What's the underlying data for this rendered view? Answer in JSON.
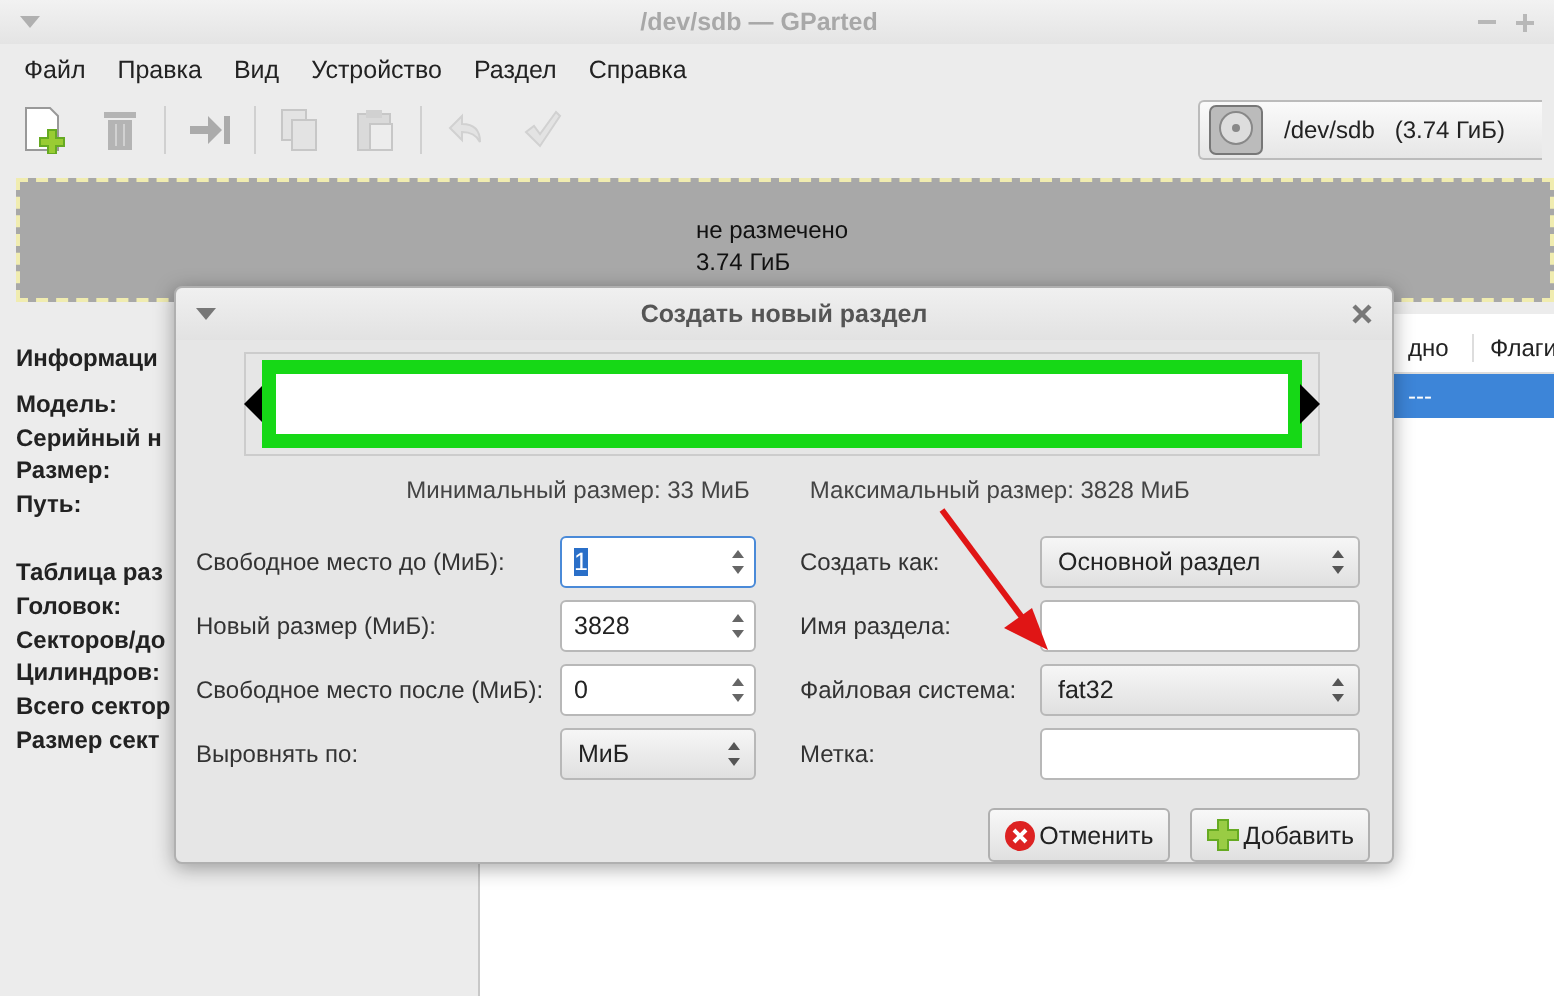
{
  "window": {
    "title": "/dev/sdb — GParted"
  },
  "menu": [
    "Файл",
    "Правка",
    "Вид",
    "Устройство",
    "Раздел",
    "Справка"
  ],
  "toolbar": [
    {
      "kind": "new",
      "disabled": false
    },
    {
      "kind": "delete",
      "disabled": true
    },
    {
      "kind": "resize",
      "disabled": true
    },
    {
      "kind": "copy",
      "disabled": true
    },
    {
      "kind": "paste",
      "disabled": true
    },
    {
      "kind": "undo",
      "disabled": true
    },
    {
      "kind": "apply",
      "disabled": true
    }
  ],
  "device_selector": {
    "device": "/dev/sdb",
    "size": "(3.74 ГиБ)"
  },
  "disk_map": {
    "label": "не размечено",
    "size": "3.74 ГиБ"
  },
  "info_panel": {
    "labels": [
      "Информаци",
      "Модель:",
      "Серийный н",
      "Размер:",
      "Путь:",
      "Таблица раз",
      "Головок:",
      "Секторов/до",
      "Цилиндров:",
      "Всего сектор",
      "Размер сект"
    ]
  },
  "partition_table": {
    "columns": [
      "дно",
      "Флаги"
    ],
    "rows": [
      {
        "cells": [
          "---"
        ],
        "selected": true
      }
    ]
  },
  "dialog": {
    "title": "Создать новый раздел",
    "min_size": "Минимальный размер: 33 МиБ",
    "max_size": "Максимальный размер: 3828 МиБ",
    "left_fields": [
      {
        "label": "Свободное место до (МиБ):",
        "kind": "spin",
        "value": "1",
        "focused": true
      },
      {
        "label": "Новый размер (МиБ):",
        "kind": "spin",
        "value": "3828",
        "focused": false
      },
      {
        "label": "Свободное место после (МиБ):",
        "kind": "spin",
        "value": "0",
        "focused": false
      },
      {
        "label": "Выровнять по:",
        "kind": "combo",
        "value": "МиБ",
        "focused": false
      }
    ],
    "right_fields": [
      {
        "label": "Создать как:",
        "kind": "combo",
        "value": "Основной раздел",
        "focused": false
      },
      {
        "label": "Имя раздела:",
        "kind": "entry",
        "focused": false
      },
      {
        "label": "Файловая система:",
        "kind": "combo",
        "value": "fat32",
        "focused": false
      },
      {
        "label": "Метка:",
        "kind": "entry",
        "focused": false
      }
    ],
    "buttons": [
      {
        "label": "Отменить",
        "kind": "cancel"
      },
      {
        "label": "Добавить",
        "kind": "add"
      }
    ]
  }
}
